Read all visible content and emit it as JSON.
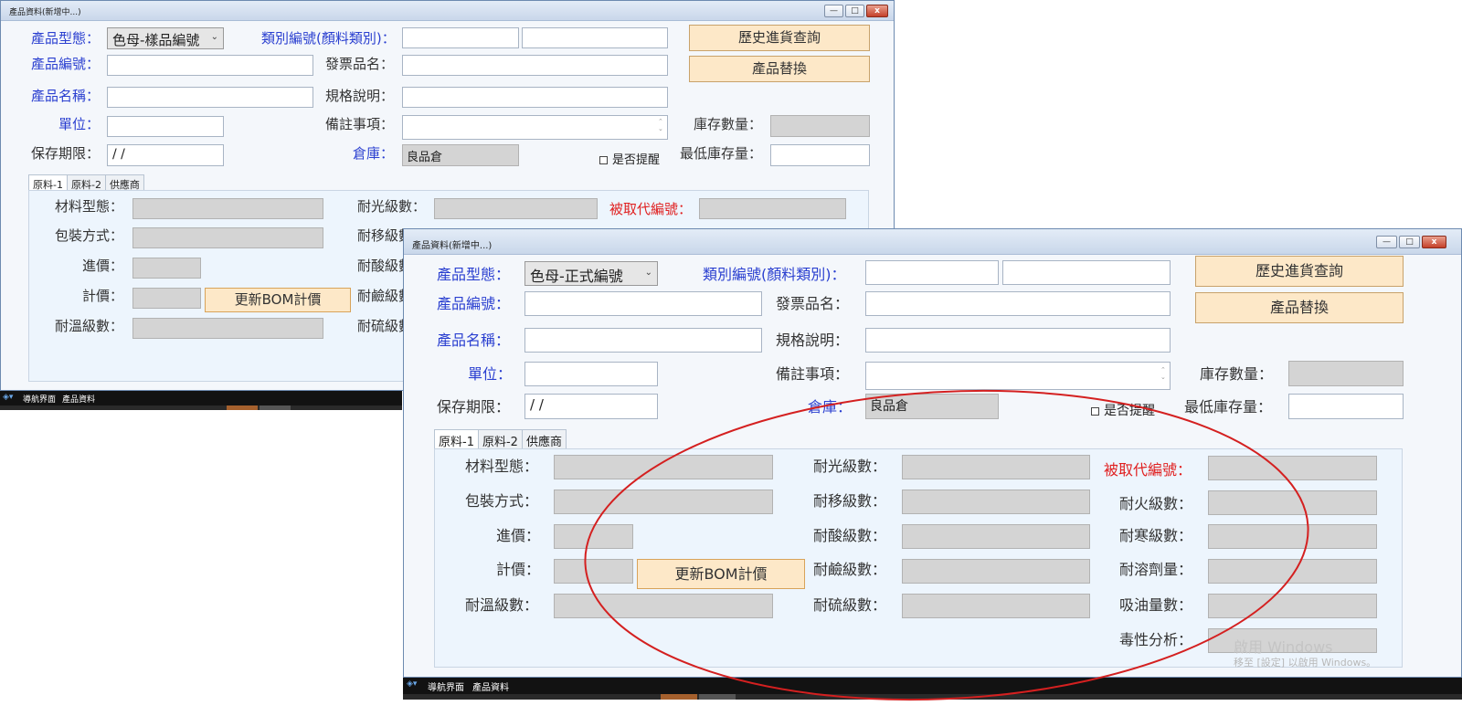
{
  "back_window": {
    "title": "產品資料(新增中...)",
    "controls": {
      "minimize": "—",
      "restore": "□",
      "close": "x"
    },
    "labels": {
      "product_type": "產品型態：",
      "category_code": "類別編號(顏料類別)：",
      "product_code": "產品編號：",
      "invoice_name": "發票品名：",
      "product_name": "產品名稱：",
      "spec": "規格說明：",
      "unit": "單位：",
      "remarks": "備註事項：",
      "stock_qty": "庫存數量：",
      "shelf_life": "保存期限：",
      "warehouse": "倉庫：",
      "min_stock": "最低庫存量："
    },
    "product_type_value": "色母-樣品編號",
    "shelf_life_value": " / /",
    "warehouse_value": "良品倉",
    "reminder_label": "是否提醒",
    "buttons": {
      "history": "歷史進貨查詢",
      "replace": "產品替換",
      "update_bom": "更新BOM計價"
    },
    "tabs": [
      "原料-1",
      "原料-2",
      "供應商"
    ],
    "panel": {
      "material_type": "材料型態：",
      "light_fastness": "耐光級數：",
      "replaced_code": "被取代編號：",
      "packaging": "包裝方式：",
      "migration": "耐移級數",
      "purchase_price": "進價：",
      "acid": "耐酸級數",
      "pricing": "計價：",
      "alkali": "耐鹼級數",
      "heat": "耐溫級數：",
      "sulfur": "耐硫級數"
    }
  },
  "front_window": {
    "title": "產品資料(新增中...)",
    "controls": {
      "minimize": "—",
      "restore": "□",
      "close": "x"
    },
    "labels": {
      "product_type": "產品型態：",
      "category_code": "類別編號(顏料類別)：",
      "product_code": "產品編號：",
      "invoice_name": "發票品名：",
      "product_name": "產品名稱：",
      "spec": "規格說明：",
      "unit": "單位：",
      "remarks": "備註事項：",
      "stock_qty": "庫存數量：",
      "shelf_life": "保存期限：",
      "warehouse": "倉庫：",
      "min_stock": "最低庫存量："
    },
    "product_type_value": "色母-正式編號",
    "shelf_life_value": " / /",
    "warehouse_value": "良品倉",
    "reminder_label": "是否提醒",
    "buttons": {
      "history": "歷史進貨查詢",
      "replace": "產品替換",
      "update_bom": "更新BOM計價"
    },
    "tabs": [
      "原料-1",
      "原料-2",
      "供應商"
    ],
    "panel": {
      "material_type": "材料型態：",
      "light_fastness": "耐光級數：",
      "replaced_code": "被取代編號：",
      "packaging": "包裝方式：",
      "migration": "耐移級數：",
      "fire": "耐火級數：",
      "purchase_price": "進價：",
      "acid": "耐酸級數：",
      "cold": "耐寒級數：",
      "pricing": "計價：",
      "alkali": "耐鹼級數：",
      "solvent": "耐溶劑量：",
      "heat": "耐溫級數：",
      "sulfur": "耐硫級數：",
      "oil_absorption": "吸油量數：",
      "toxicity": "毒性分析："
    }
  },
  "taskbar": {
    "nav": "導航界面",
    "product": "產品資料"
  },
  "watermark": {
    "line1": "啟用 Windows",
    "line2": "移至 [設定] 以啟用 Windows。"
  },
  "colors": {
    "label_blue": "#2a3fd0",
    "label_red": "#e02020",
    "button_bg": "#fde8c8",
    "annotation": "#d42020"
  }
}
